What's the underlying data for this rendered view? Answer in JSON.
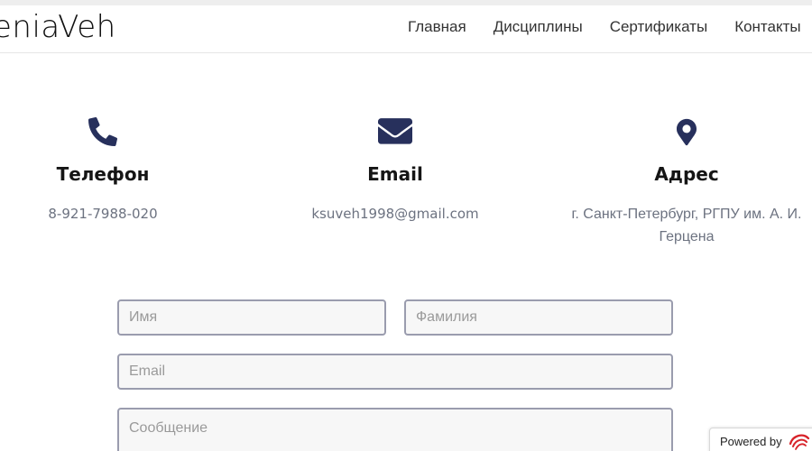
{
  "header": {
    "logo": "eniaVeh",
    "nav": [
      "Главная",
      "Дисциплины",
      "Сертификаты",
      "Контакты"
    ]
  },
  "contacts": {
    "phone": {
      "icon": "phone-icon",
      "title": "Телефон",
      "value": "8-921-7988-020"
    },
    "email": {
      "icon": "envelope-icon",
      "title": "Email",
      "value": "ksuveh1998@gmail.com"
    },
    "address": {
      "icon": "map-marker-icon",
      "title": "Адрес",
      "value": "г. Санкт-Петербург, РГПУ им. А. И. Герцена"
    }
  },
  "form": {
    "first_name_placeholder": "Имя",
    "last_name_placeholder": "Фамилия",
    "email_placeholder": "Email",
    "message_placeholder": "Сообщение"
  },
  "badge": {
    "label": "Powered by",
    "icon": "brand-swirl-icon"
  },
  "colors": {
    "icon": "#27305c",
    "field_border": "#9a9cae",
    "muted_text": "#6c7280",
    "badge_icon": "#d8232a"
  }
}
